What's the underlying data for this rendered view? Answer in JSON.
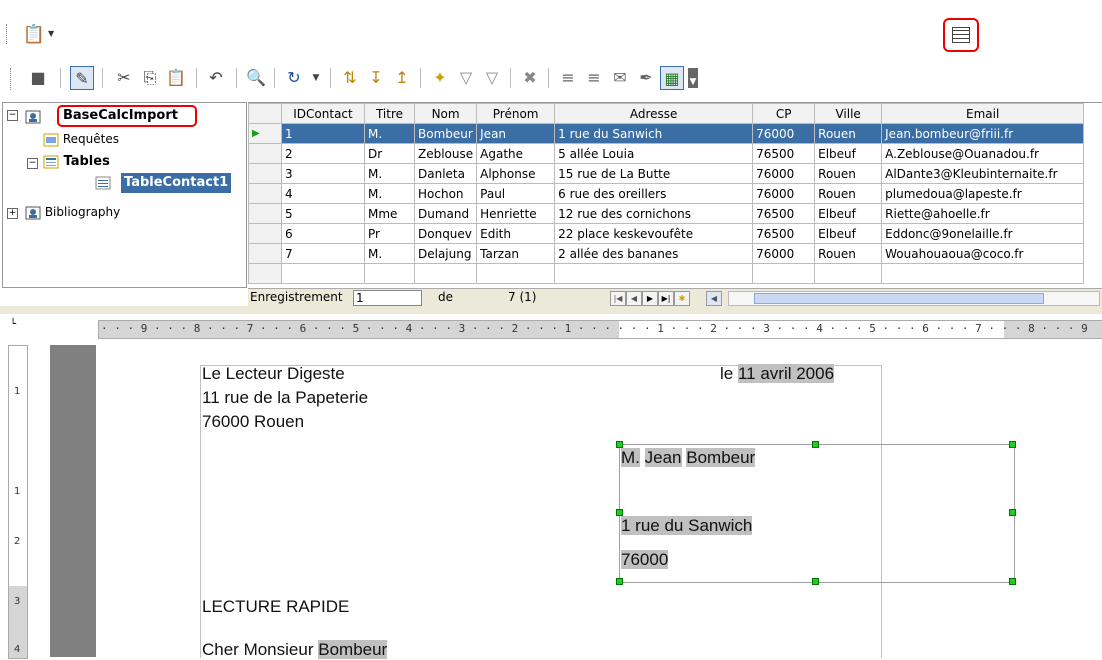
{
  "toolbar_top": {
    "datasource_icon": "database-icon",
    "explorer_icon": "table-explorer-icon"
  },
  "tree": {
    "root": "BaseCalcImport",
    "queries": "Requêtes",
    "tables": "Tables",
    "table_selected": "TableContact1",
    "other_db": "Bibliography"
  },
  "grid": {
    "columns": [
      "IDContact",
      "Titre",
      "Nom",
      "Prénom",
      "Adresse",
      "CP",
      "Ville",
      "Email"
    ],
    "rows": [
      [
        "1",
        "M.",
        "Bombeur",
        "Jean",
        "1 rue du Sanwich",
        "76000",
        "Rouen",
        "Jean.bombeur@friii.fr"
      ],
      [
        "2",
        "Dr",
        "Zeblouse",
        "Agathe",
        "5 allée Louia",
        "76500",
        "Elbeuf",
        "A.Zeblouse@Ouanadou.fr"
      ],
      [
        "3",
        "M.",
        "Danleta",
        "Alphonse",
        "15 rue de La Butte",
        "76000",
        "Rouen",
        "AlDante3@Kleubinternaite.fr"
      ],
      [
        "4",
        "M.",
        "Hochon",
        "Paul",
        "6 rue des oreillers",
        "76000",
        "Rouen",
        "plumedoua@lapeste.fr"
      ],
      [
        "5",
        "Mme",
        "Dumand",
        "Henriette",
        "12 rue des cornichons",
        "76500",
        "Elbeuf",
        "Riette@ahoelle.fr"
      ],
      [
        "6",
        "Pr",
        "Donquev",
        "Edith",
        "22 place keskevoufête",
        "76500",
        "Elbeuf",
        "Eddonc@9onelaille.fr"
      ],
      [
        "7",
        "M.",
        "Delajung",
        "Tarzan",
        "2 allée des bananes",
        "76000",
        "Rouen",
        "Wouahouaoua@coco.fr"
      ]
    ]
  },
  "recnav": {
    "label": "Enregistrement",
    "current": "1",
    "of_label": "de",
    "total": "7 (1)"
  },
  "ruler": {
    "text": "· · · 9 · · · 8 · · · 7 · · · 6 · · · 5 · · · 4 · · · 3 · · · 2 · · · 1 · · ·    · · · 1 · · · 2 · · · 3 · · · 4 · · · 5 · · · 6 · · · 7 · · · 8 · · · 9",
    "vertical": [
      "1",
      "1",
      "2",
      "3",
      "4"
    ]
  },
  "letter": {
    "sender_name": "Le Lecteur Digeste",
    "sender_street": "11 rue de la Papeterie",
    "sender_city": "76000 Rouen",
    "date_prefix": "le",
    "date_value": "11 avril 2006",
    "recipient_title": "M.",
    "recipient_first": "Jean",
    "recipient_last": "Bombeur",
    "recipient_address": "1 rue du Sanwich",
    "recipient_cp": "76000",
    "subject": "LECTURE RAPIDE",
    "greeting": "Cher Monsieur",
    "greeting_name": "Bombeur"
  }
}
